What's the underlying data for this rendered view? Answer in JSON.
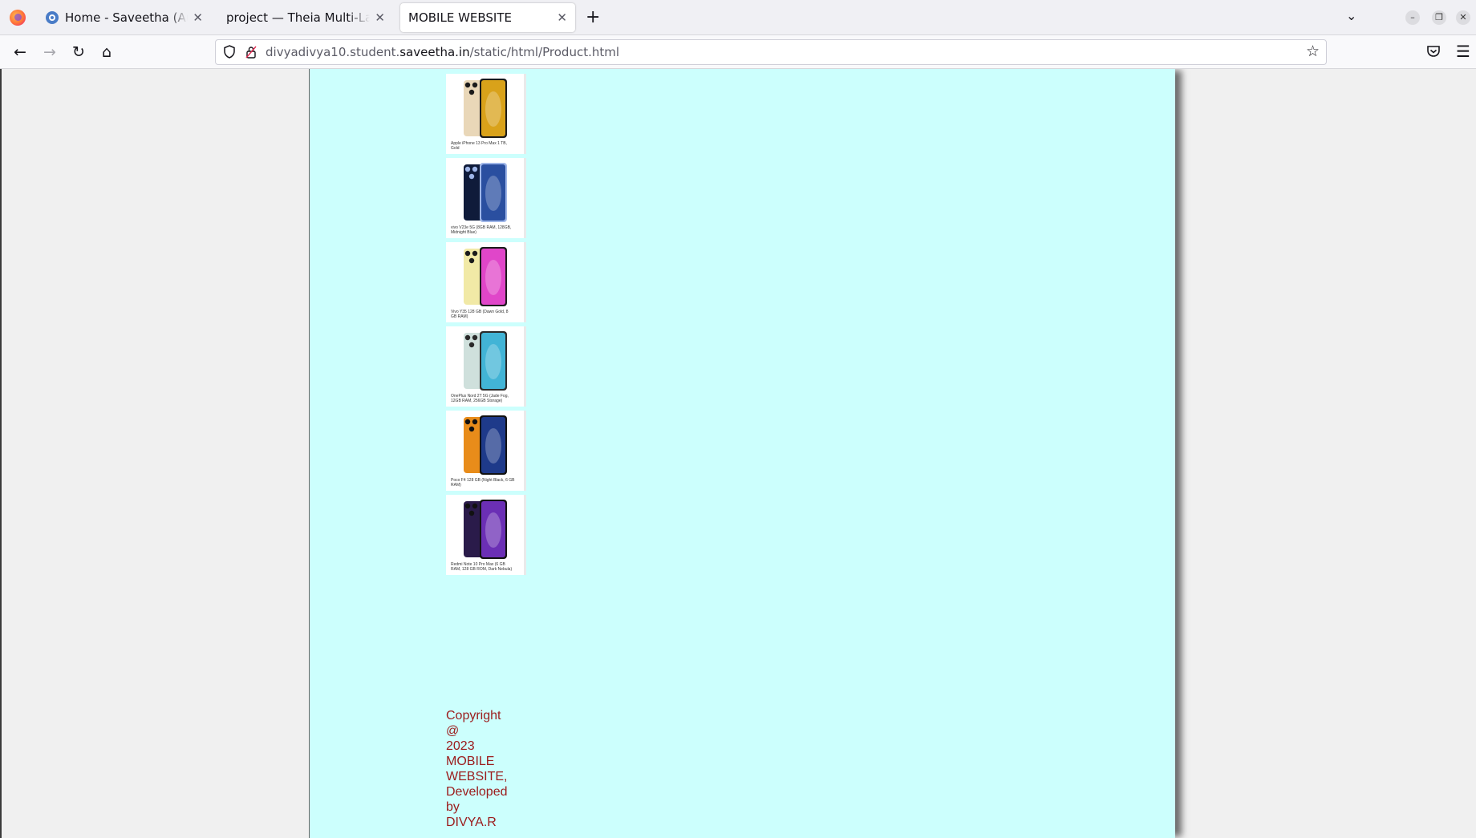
{
  "browser": {
    "tabs": [
      {
        "title": "Home - Saveetha (Autonomous)",
        "active": false
      },
      {
        "title": "project — Theia Multi-Language Example",
        "active": false
      },
      {
        "title": "MOBILE WEBSITE",
        "active": true
      }
    ],
    "url": {
      "prefix": "divyadivya10.student.",
      "domain": "saveetha.in",
      "path": "/static/html/Product.html"
    },
    "icons": {
      "back": "back-arrow-icon",
      "forward": "forward-arrow-icon",
      "reload": "reload-icon",
      "home": "home-icon"
    }
  },
  "products": [
    {
      "caption": "Apple iPhone 13 Pro Max 1 TB, Gold",
      "colors": [
        "#e9d7b8",
        "#d9a21a",
        "#1a1a1a"
      ]
    },
    {
      "caption": "vivo V23e 5G (8GB RAM, 128GB, Midnight Blue)",
      "colors": [
        "#0f1b3a",
        "#2a4fa0",
        "#9fb6e8"
      ]
    },
    {
      "caption": "Vivo Y35 128 GB (Dawn Gold, 8 GB RAM)",
      "colors": [
        "#f1e9a6",
        "#e046c9",
        "#1b1b1b"
      ]
    },
    {
      "caption": "OnePlus Nord 2T 5G (Jade Fog, 12GB RAM, 256GB Storage)",
      "colors": [
        "#cfe0dc",
        "#42b4d6",
        "#2a2a2a"
      ]
    },
    {
      "caption": "Poco F4 128 GB (Night Black, 6 GB RAM)",
      "colors": [
        "#e88c1a",
        "#1e3a8a",
        "#111111"
      ]
    },
    {
      "caption": "Redmi Note 10 Pro Max (6 GB RAM, 128 GB ROM, Dark Nebula)",
      "colors": [
        "#2a1b4a",
        "#6b2fb5",
        "#111111"
      ]
    }
  ],
  "footer": {
    "lines": [
      "Copyright",
      "@",
      "2023",
      "MOBILE",
      "WEBSITE,",
      "Developed",
      "by",
      "DIVYA.R"
    ]
  }
}
